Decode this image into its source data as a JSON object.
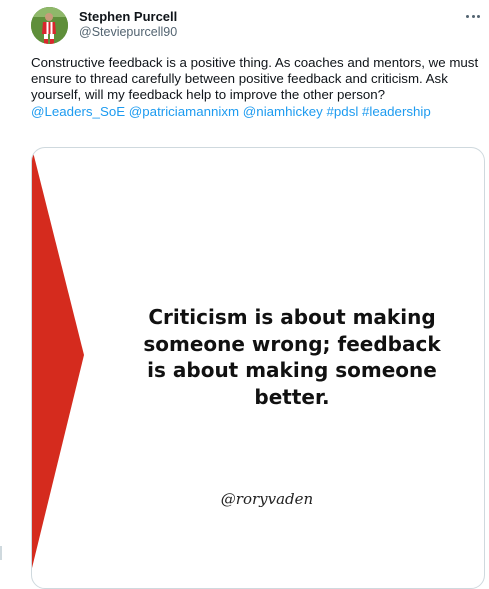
{
  "tweet": {
    "author": {
      "name": "Stephen Purcell",
      "handle": "@Steviepurcell90"
    },
    "text_segments": [
      {
        "text": "Constructive feedback is a positive thing. As coaches and mentors, we must ensure to thread carefully between positive feedback and criticism. Ask yourself, will my feedback help to improve the other person? ",
        "type": "plain"
      },
      {
        "text": "@Leaders_SoE",
        "type": "mention"
      },
      {
        "text": " ",
        "type": "plain"
      },
      {
        "text": "@patriciamannixm",
        "type": "mention"
      },
      {
        "text": " ",
        "type": "plain"
      },
      {
        "text": "@niamhickey",
        "type": "mention"
      },
      {
        "text": "  ",
        "type": "plain"
      },
      {
        "text": "#pdsl",
        "type": "hashtag"
      },
      {
        "text": " ",
        "type": "plain"
      },
      {
        "text": "#leadership",
        "type": "hashtag"
      }
    ],
    "more_icon": "more-horizontal-icon"
  },
  "media": {
    "quote": "Criticism is about making someone wrong; feedback is about making someone better.",
    "signature": "@roryvaden",
    "accent_color": "#d52b1e"
  },
  "colors": {
    "link": "#1d9bf0",
    "text": "#0f1419",
    "secondary": "#536471",
    "border": "#cfd9de"
  }
}
